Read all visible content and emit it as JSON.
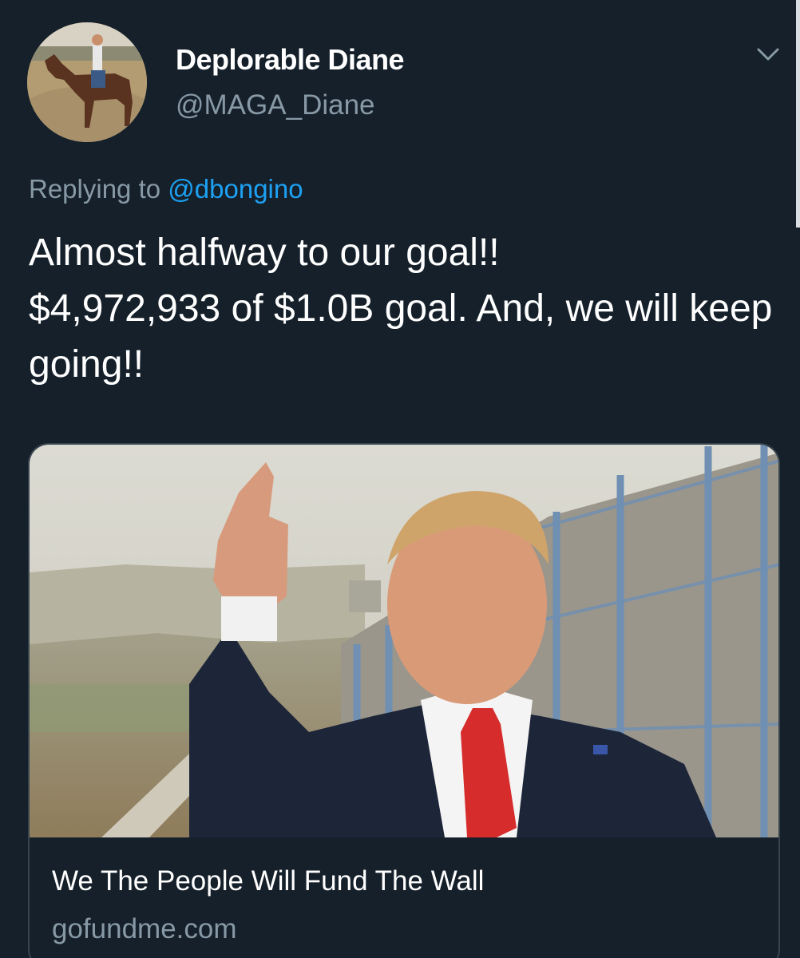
{
  "author": {
    "display_name": "Deplorable Diane",
    "handle": "@MAGA_Diane"
  },
  "reply": {
    "prefix": "Replying to",
    "mention": "@dbongino"
  },
  "tweet": {
    "text": "Almost halfway to our goal!!\n$4,972,933 of $1.0B goal.  And, we will keep going!!"
  },
  "link_card": {
    "title": "We The People Will Fund The Wall",
    "domain": "gofundme.com"
  },
  "colors": {
    "background": "#15202b",
    "secondary_text": "#8899a6",
    "link": "#1da1f2",
    "border": "#38444d"
  },
  "icons": {
    "menu": "chevron-down-icon"
  }
}
